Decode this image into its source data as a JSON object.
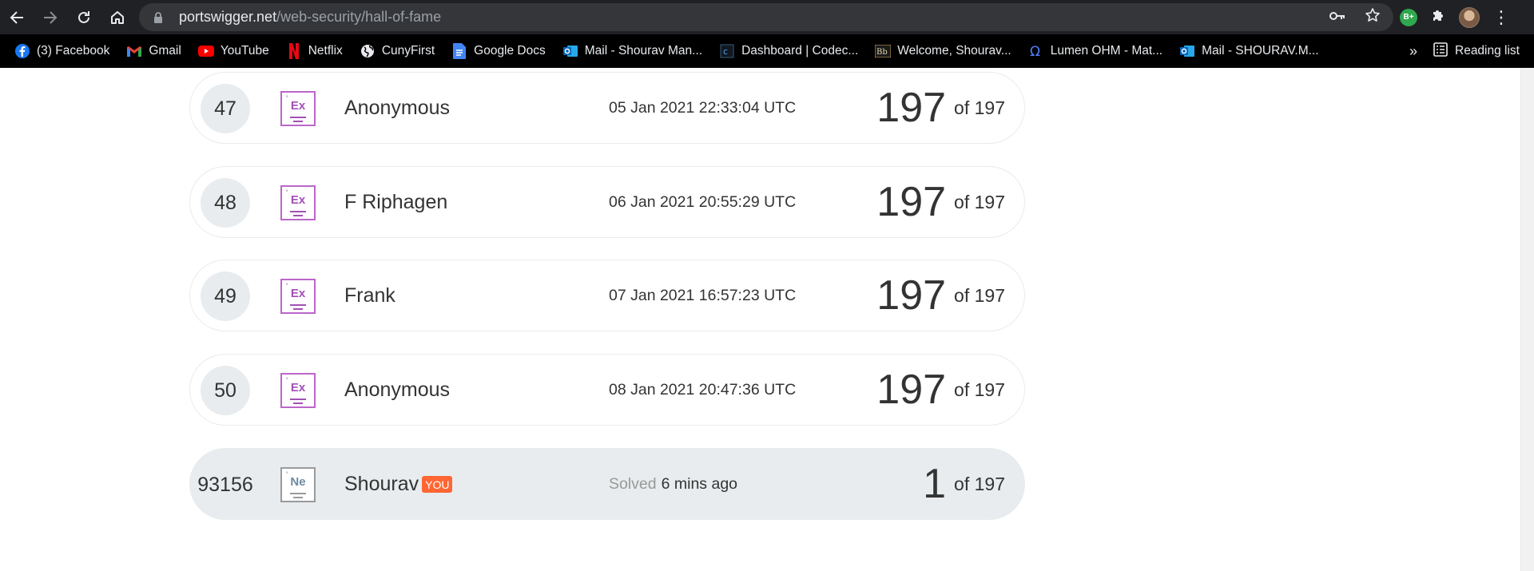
{
  "browser": {
    "url_host": "portswigger.net",
    "url_path": "/web-security/hall-of-fame",
    "profile_badge": "B+"
  },
  "bookmarks": [
    {
      "label": "(3) Facebook",
      "icon": "facebook-icon"
    },
    {
      "label": "Gmail",
      "icon": "gmail-icon"
    },
    {
      "label": "YouTube",
      "icon": "youtube-icon"
    },
    {
      "label": "Netflix",
      "icon": "netflix-icon"
    },
    {
      "label": "CunyFirst",
      "icon": "globe-icon"
    },
    {
      "label": "Google Docs",
      "icon": "google-docs-icon"
    },
    {
      "label": "Mail - Shourav Man...",
      "icon": "outlook-icon"
    },
    {
      "label": "Dashboard | Codec...",
      "icon": "codecademy-icon"
    },
    {
      "label": "Welcome, Shourav...",
      "icon": "blackboard-icon"
    },
    {
      "label": "Lumen OHM - Mat...",
      "icon": "lumen-icon"
    },
    {
      "label": "Mail - SHOURAV.M...",
      "icon": "outlook-icon"
    }
  ],
  "bookmarks_more": "»",
  "reading_list": "Reading list",
  "entries": [
    {
      "rank": "47",
      "level": "Ex",
      "name": "Anonymous",
      "date": "05 Jan 2021 22:33:04 UTC",
      "score": "197",
      "of": "of 197"
    },
    {
      "rank": "48",
      "level": "Ex",
      "name": "F Riphagen",
      "date": "06 Jan 2021 20:55:29 UTC",
      "score": "197",
      "of": "of 197"
    },
    {
      "rank": "49",
      "level": "Ex",
      "name": "Frank",
      "date": "07 Jan 2021 16:57:23 UTC",
      "score": "197",
      "of": "of 197"
    },
    {
      "rank": "50",
      "level": "Ex",
      "name": "Anonymous",
      "date": "08 Jan 2021 20:47:36 UTC",
      "score": "197",
      "of": "of 197"
    }
  ],
  "you": {
    "rank": "93156",
    "level": "Ne",
    "name": "Shourav",
    "badge": "YOU",
    "solved_label": "Solved",
    "solved_time": "6 mins ago",
    "score": "1",
    "of": "of 197"
  },
  "colors": {
    "expert": "#bb66c9",
    "you_badge": "#ff6633",
    "row_highlight": "#e8ecee"
  }
}
